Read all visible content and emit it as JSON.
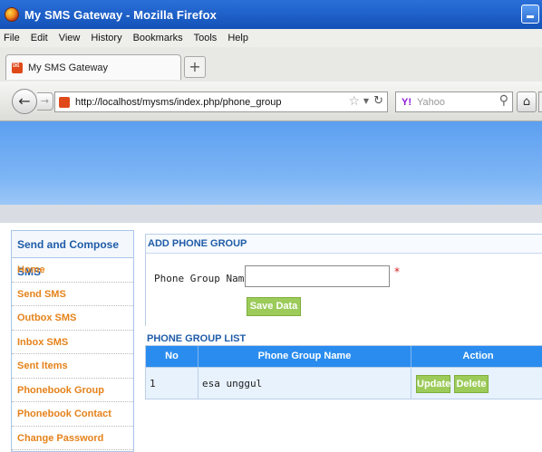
{
  "window": {
    "title": "My SMS Gateway - Mozilla Firefox"
  },
  "menu": [
    "File",
    "Edit",
    "View",
    "History",
    "Bookmarks",
    "Tools",
    "Help"
  ],
  "tab": {
    "label": "My SMS Gateway",
    "new_tab": "+"
  },
  "nav": {
    "url": "http://localhost/mysms/index.php/phone_group",
    "search_engine": "Yahoo",
    "search_logo": "Y!"
  },
  "sidebar": {
    "heading": "Send and Compose SMS",
    "items": [
      "Home",
      "Send SMS",
      "Outbox SMS",
      "Inbox SMS",
      "Sent Items",
      "Phonebook Group",
      "Phonebook Contact",
      "Change Password"
    ]
  },
  "form": {
    "title": "ADD PHONE GROUP",
    "label": "Phone Group Name",
    "value": "",
    "required_mark": "*",
    "save_label": "Save Data"
  },
  "list": {
    "title": "PHONE GROUP LIST",
    "headers": [
      "No",
      "Phone Group Name",
      "Action"
    ],
    "rows": [
      {
        "no": "1",
        "name": "esa unggul"
      }
    ],
    "update_label": "Update",
    "delete_label": "Delete"
  },
  "colors": {
    "accent": "#2a8cee",
    "button": "#9ccb5a",
    "sidebar_link": "#e5821a",
    "heading": "#1f5ca8"
  }
}
